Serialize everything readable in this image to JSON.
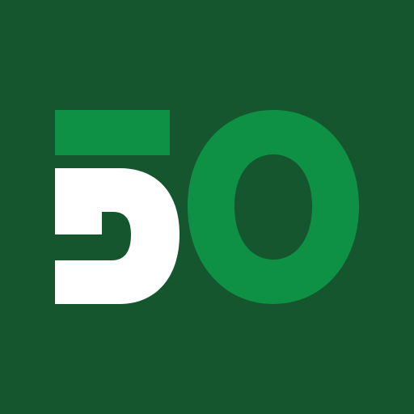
{
  "logo": {
    "text": "50",
    "colors": {
      "background": "#15562F",
      "accent_green": "#0F9145",
      "white": "#FFFFFF"
    }
  }
}
